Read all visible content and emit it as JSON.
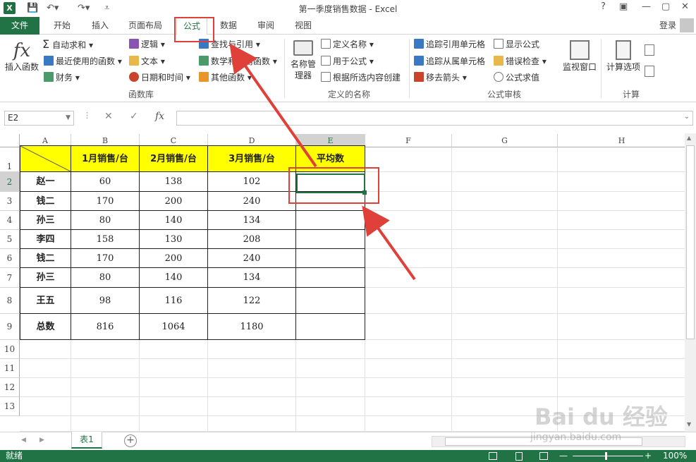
{
  "window": {
    "title": "第一季度销售数据 - Excel",
    "app_icon": "X",
    "controls": [
      "?",
      "▣",
      "—",
      "▢",
      "✕"
    ]
  },
  "ribbon_tabs": [
    "文件",
    "开始",
    "插入",
    "页面布局",
    "公式",
    "数据",
    "审阅",
    "视图"
  ],
  "active_tab": "公式",
  "login": "登录",
  "ribbon": {
    "insert_function": "插入函数",
    "autosum": "自动求和",
    "recent": "最近使用的函数",
    "finance": "财务",
    "logic": "逻辑",
    "text": "文本",
    "datetime": "日期和时间",
    "lookup": "查找与引用",
    "math": "数学和三角函数",
    "other": "其他函数",
    "library_group": "函数库",
    "name_manager": "名称管理器",
    "define_name": "定义名称",
    "use_in_formula": "用于公式",
    "create_from_sel": "根据所选内容创建",
    "defined_names_group": "定义的名称",
    "trace_precedents": "追踪引用单元格",
    "trace_dependents": "追踪从属单元格",
    "remove_arrows": "移去箭头",
    "show_formulas": "显示公式",
    "error_checking": "错误检查",
    "evaluate": "公式求值",
    "watch_window": "监视窗口",
    "audit_group": "公式审核",
    "calc_options": "计算选项",
    "calc_group": "计算"
  },
  "name_box": "E2",
  "fx_label": "fx",
  "columns": [
    "A",
    "B",
    "C",
    "D",
    "E",
    "F",
    "G",
    "H"
  ],
  "rows": [
    "1",
    "2",
    "3",
    "4",
    "5",
    "6",
    "7",
    "8",
    "9",
    "10",
    "11",
    "12",
    "13"
  ],
  "table": {
    "headers": [
      "1月销售/台",
      "2月销售/台",
      "3月销售/台",
      "平均数"
    ],
    "data": [
      [
        "赵一",
        "60",
        "138",
        "102",
        ""
      ],
      [
        "钱二",
        "170",
        "200",
        "240",
        ""
      ],
      [
        "孙三",
        "80",
        "140",
        "134",
        ""
      ],
      [
        "李四",
        "158",
        "130",
        "208",
        ""
      ],
      [
        "钱二",
        "170",
        "200",
        "240",
        ""
      ],
      [
        "孙三",
        "80",
        "140",
        "134",
        ""
      ],
      [
        "王五",
        "98",
        "116",
        "122",
        ""
      ],
      [
        "总数",
        "816",
        "1064",
        "1180",
        ""
      ]
    ]
  },
  "sheet_tab": "表1",
  "add_sheet": "+",
  "status_left": "就绪",
  "zoom": "100%",
  "watermark": "Bai du 经验",
  "watermark_sub": "jingyan.baidu.com",
  "colors": {
    "excel_green": "#217346",
    "header_fill": "#ffff00",
    "callout": "#e0403a"
  }
}
